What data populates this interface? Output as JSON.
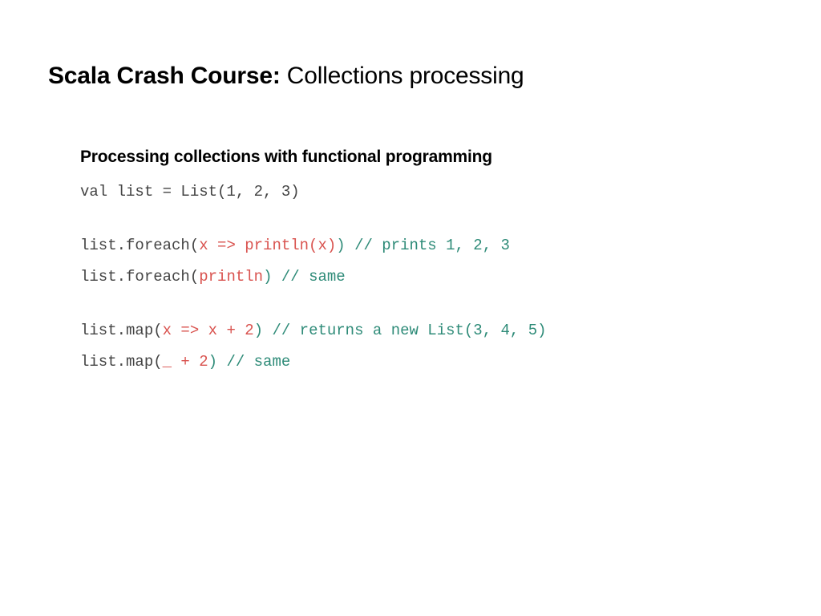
{
  "title": {
    "bold": "Scala Crash Course:",
    "rest": " Collections processing"
  },
  "subtitle": "Processing collections with functional programming",
  "lines": {
    "l1": "val list = List(1, 2, 3)",
    "l2_a": "list.foreach(",
    "l2_b": "x => println(x)",
    "l2_c": ")",
    "l2_d": " // prints 1, 2, 3",
    "l3_a": "list.foreach(",
    "l3_b": "println",
    "l3_c": ")",
    "l3_d": " // same",
    "l4_a": "list.map(",
    "l4_b": "x => x + 2",
    "l4_c": ")",
    "l4_d": " // returns a new List(3, 4, 5)",
    "l5_a": "list.map(",
    "l5_b": "_ + 2",
    "l5_c": ")",
    "l5_d": " // same"
  }
}
